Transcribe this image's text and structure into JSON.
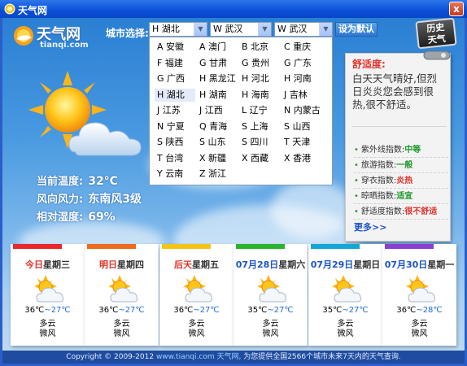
{
  "window": {
    "title": "天气网",
    "close_glyph": "x"
  },
  "logo": {
    "name": "天气网",
    "url": "tianqi.com"
  },
  "city_select": {
    "label": "城市选择:",
    "province": "H 湖北",
    "city": "W 武汉",
    "district": "W 武汉",
    "set_default": "设为默认",
    "options": [
      "A 安徽",
      "A 澳门",
      "B 北京",
      "C 重庆",
      "F 福建",
      "G 甘肃",
      "G 贵州",
      "G 广东",
      "G 广西",
      "H 黑龙江",
      "H 河北",
      "H 河南",
      "H 湖北",
      "H 湖南",
      "H 海南",
      "J 吉林",
      "J 江苏",
      "J 江西",
      "L 辽宁",
      "N 内蒙古",
      "N 宁夏",
      "Q 青海",
      "S 上海",
      "S 山西",
      "S 陕西",
      "S 山东",
      "S 四川",
      "T 天津",
      "T 台湾",
      "X 新疆",
      "X 西藏",
      "X 香港",
      "Y 云南",
      "Z 浙江"
    ],
    "selected_option": "H 湖北"
  },
  "history_button": {
    "line1": "历史",
    "line2": "天气"
  },
  "current": {
    "temp_label": "当前温度:",
    "temp_value": "32°C",
    "wind_label": "风向风力:",
    "wind_value": "东南风3级",
    "humidity_label": "相对湿度:",
    "humidity_value": "69%"
  },
  "comfort": {
    "heading": "舒适度:",
    "text": "白天天气晴好,但烈日炎炎您会感到很热,很不舒适。",
    "indices": [
      {
        "label": "紫外线指数:",
        "value": "中等",
        "color": "#1e9a2a"
      },
      {
        "label": "旅游指数:",
        "value": "一般",
        "color": "#1e9a2a"
      },
      {
        "label": "穿衣指数:",
        "value": "炎热",
        "color": "#e0322a"
      },
      {
        "label": "晾晒指数:",
        "value": "适宜",
        "color": "#1e9a2a"
      },
      {
        "label": "舒适度指数:",
        "value": "很不舒适",
        "color": "#e0322a"
      }
    ],
    "more": "更多>>"
  },
  "forecast": [
    {
      "prefix": "今日",
      "rest": "星期三",
      "band": "#e8282a",
      "hi": "36℃",
      "lo": "~27℃",
      "desc": "多云",
      "wind": "微风"
    },
    {
      "prefix": "明日",
      "rest": "星期四",
      "band": "#ee6b1c",
      "hi": "36℃",
      "lo": "~27℃",
      "desc": "多云",
      "wind": "微风"
    },
    {
      "prefix": "后天",
      "rest": "星期五",
      "band": "#f2c515",
      "hi": "36℃",
      "lo": "~27℃",
      "desc": "多云",
      "wind": "微风"
    },
    {
      "prefix": "07月28日",
      "rest": "星期六",
      "band": "#2bb32f",
      "hi": "35℃",
      "lo": "~27℃",
      "desc": "多云",
      "wind": "微风"
    },
    {
      "prefix": "07月29日",
      "rest": "星期日",
      "band": "#15a6d6",
      "hi": "35℃",
      "lo": "~27℃",
      "desc": "多云",
      "wind": "微风"
    },
    {
      "prefix": "07月30日",
      "rest": "星期一",
      "band": "#8b3fd0",
      "hi": "36℃",
      "lo": "~28℃",
      "desc": "多云",
      "wind": "微风"
    }
  ],
  "footer": {
    "copyright": "Copyright © 2009-2012",
    "site": "www.tianqi.com 天气网,",
    "text": "为您提供全国2566个城市未来7天内的天气查询."
  }
}
